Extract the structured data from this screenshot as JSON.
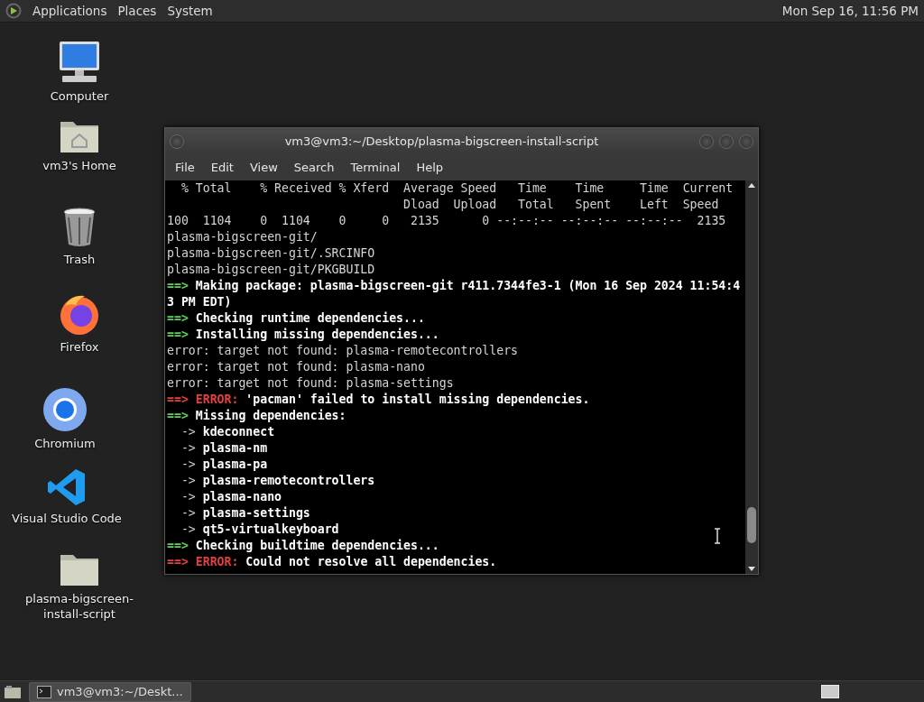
{
  "top_panel": {
    "menus": [
      "Applications",
      "Places",
      "System"
    ],
    "clock": "Mon Sep 16, 11:56 PM"
  },
  "desktop_icons": [
    {
      "kind": "computer",
      "label": "Computer"
    },
    {
      "kind": "home",
      "label": "vm3's Home"
    },
    {
      "kind": "trash",
      "label": "Trash"
    },
    {
      "kind": "firefox",
      "label": "Firefox"
    },
    {
      "kind": "chromium",
      "label": "Chromium"
    },
    {
      "kind": "vscode",
      "label": "Visual Studio Code"
    },
    {
      "kind": "folder",
      "label": "plasma-bigscreen-install-script"
    }
  ],
  "terminal": {
    "title": "vm3@vm3:~/Desktop/plasma-bigscreen-install-script",
    "menu": [
      "File",
      "Edit",
      "View",
      "Search",
      "Terminal",
      "Help"
    ],
    "lines": [
      [
        {
          "kind": "plain",
          "text": "  % Total    % Received % Xferd  Average Speed   Time    Time     Time  Current"
        }
      ],
      [
        {
          "kind": "plain",
          "text": "                                 Dload  Upload   Total   Spent    Left  Speed"
        }
      ],
      [
        {
          "kind": "plain",
          "text": "100  1104    0  1104    0     0   2135      0 --:--:-- --:--:-- --:--:--  2135"
        }
      ],
      [
        {
          "kind": "plain",
          "text": "plasma-bigscreen-git/"
        }
      ],
      [
        {
          "kind": "plain",
          "text": "plasma-bigscreen-git/.SRCINFO"
        }
      ],
      [
        {
          "kind": "plain",
          "text": "plasma-bigscreen-git/PKGBUILD"
        }
      ],
      [
        {
          "kind": "arrow",
          "text": "==> "
        },
        {
          "kind": "bold",
          "text": "Making package: plasma-bigscreen-git r411.7344fe3-1 (Mon 16 Sep 2024 11:54:4"
        }
      ],
      [
        {
          "kind": "bold",
          "text": "3 PM EDT)"
        }
      ],
      [
        {
          "kind": "arrow",
          "text": "==> "
        },
        {
          "kind": "bold",
          "text": "Checking runtime dependencies..."
        }
      ],
      [
        {
          "kind": "arrow",
          "text": "==> "
        },
        {
          "kind": "bold",
          "text": "Installing missing dependencies..."
        }
      ],
      [
        {
          "kind": "plain",
          "text": "error: target not found: plasma-remotecontrollers"
        }
      ],
      [
        {
          "kind": "plain",
          "text": "error: target not found: plasma-nano"
        }
      ],
      [
        {
          "kind": "plain",
          "text": "error: target not found: plasma-settings"
        }
      ],
      [
        {
          "kind": "error_arrow",
          "text": "==> "
        },
        {
          "kind": "error",
          "text": "ERROR: "
        },
        {
          "kind": "bold",
          "text": "'pacman' failed to install missing dependencies."
        }
      ],
      [
        {
          "kind": "arrow",
          "text": "==> "
        },
        {
          "kind": "bold",
          "text": "Missing dependencies:"
        }
      ],
      [
        {
          "kind": "plain",
          "text": "  -> "
        },
        {
          "kind": "bold",
          "text": "kdeconnect"
        }
      ],
      [
        {
          "kind": "plain",
          "text": "  -> "
        },
        {
          "kind": "bold",
          "text": "plasma-nm"
        }
      ],
      [
        {
          "kind": "plain",
          "text": "  -> "
        },
        {
          "kind": "bold",
          "text": "plasma-pa"
        }
      ],
      [
        {
          "kind": "plain",
          "text": "  -> "
        },
        {
          "kind": "bold",
          "text": "plasma-remotecontrollers"
        }
      ],
      [
        {
          "kind": "plain",
          "text": "  -> "
        },
        {
          "kind": "bold",
          "text": "plasma-nano"
        }
      ],
      [
        {
          "kind": "plain",
          "text": "  -> "
        },
        {
          "kind": "bold",
          "text": "plasma-settings"
        }
      ],
      [
        {
          "kind": "plain",
          "text": "  -> "
        },
        {
          "kind": "bold",
          "text": "qt5-virtualkeyboard"
        }
      ],
      [
        {
          "kind": "arrow",
          "text": "==> "
        },
        {
          "kind": "bold",
          "text": "Checking buildtime dependencies..."
        }
      ],
      [
        {
          "kind": "error_arrow",
          "text": "==> "
        },
        {
          "kind": "error",
          "text": "ERROR: "
        },
        {
          "kind": "bold",
          "text": "Could not resolve all dependencies."
        }
      ]
    ]
  },
  "taskbar": {
    "tasks": [
      {
        "label": "vm3@vm3:~/Deskt..."
      }
    ]
  }
}
